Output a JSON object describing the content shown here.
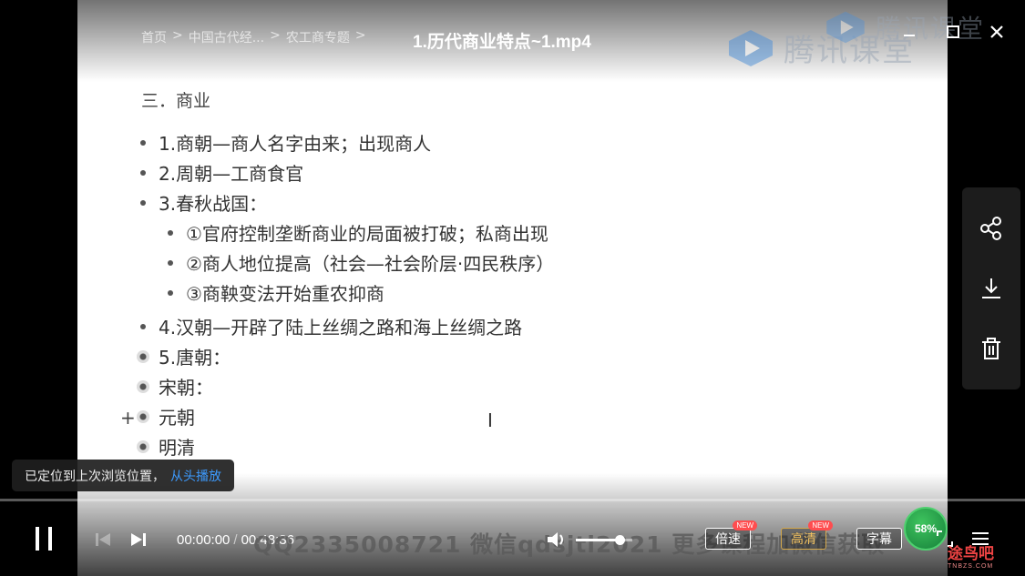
{
  "header": {
    "breadcrumb": [
      "首页",
      ">",
      "中国古代经...",
      ">",
      "农工商专题",
      ">"
    ],
    "title": "1.历代商业特点~1.mp4"
  },
  "watermarks": [
    "腾讯课堂",
    "腾讯课堂"
  ],
  "slide": {
    "section_title": "三．商业",
    "items": [
      {
        "text": "1.商朝—商人名字由来；出现商人",
        "level": 0,
        "style": "dot"
      },
      {
        "text": "2.周朝—工商食官",
        "level": 0,
        "style": "dot"
      },
      {
        "text": "3.春秋战国：",
        "level": 0,
        "style": "dot"
      },
      {
        "text": "①官府控制垄断商业的局面被打破；私商出现",
        "level": 1,
        "style": "dot"
      },
      {
        "text": "②商人地位提高（社会—社会阶层·四民秩序）",
        "level": 1,
        "style": "dot"
      },
      {
        "text": "③商鞅变法开始重农抑商",
        "level": 1,
        "style": "dot"
      },
      {
        "text": "4.汉朝—开辟了陆上丝绸之路和海上丝绸之路",
        "level": 0,
        "style": "dot"
      },
      {
        "text": "5.唐朝：",
        "level": 0,
        "style": "ring"
      },
      {
        "text": "宋朝：",
        "level": 0,
        "style": "ring"
      },
      {
        "text": "元朝",
        "level": 0,
        "style": "ring"
      },
      {
        "text": "明清",
        "level": 0,
        "style": "ring"
      }
    ],
    "plus_mark": "+",
    "cursor_glyph": "I"
  },
  "toast": {
    "message": "已定位到上次浏览位置，",
    "link": "从头播放"
  },
  "player": {
    "current_time": "00:00:00",
    "separator": "/",
    "duration": "00:48:36",
    "progress_fraction": 0,
    "volume_fraction": 0.78,
    "overlay_text": "QQ2335008721  微信qdsjtl2021  更多课程加微信获取",
    "speed_label": "倍速",
    "quality_label": "高清",
    "subtitle_label": "字幕",
    "new_badge": "NEW",
    "percent_badge": "58%"
  },
  "site_logo": {
    "name": "途鸟吧",
    "url_text": "TNBZS.COM"
  },
  "colors": {
    "accent_link": "#3d9bff",
    "new_badge": "#ff4d4f",
    "quality_border": "#d4a84c",
    "percent_badge": "#16803a"
  },
  "icons": [
    "minimize-icon",
    "restore-icon",
    "close-icon",
    "share-icon",
    "download-icon",
    "trash-icon",
    "pause-icon",
    "prev-icon",
    "next-icon",
    "volume-icon",
    "fullscreen-icon",
    "playlist-icon"
  ]
}
